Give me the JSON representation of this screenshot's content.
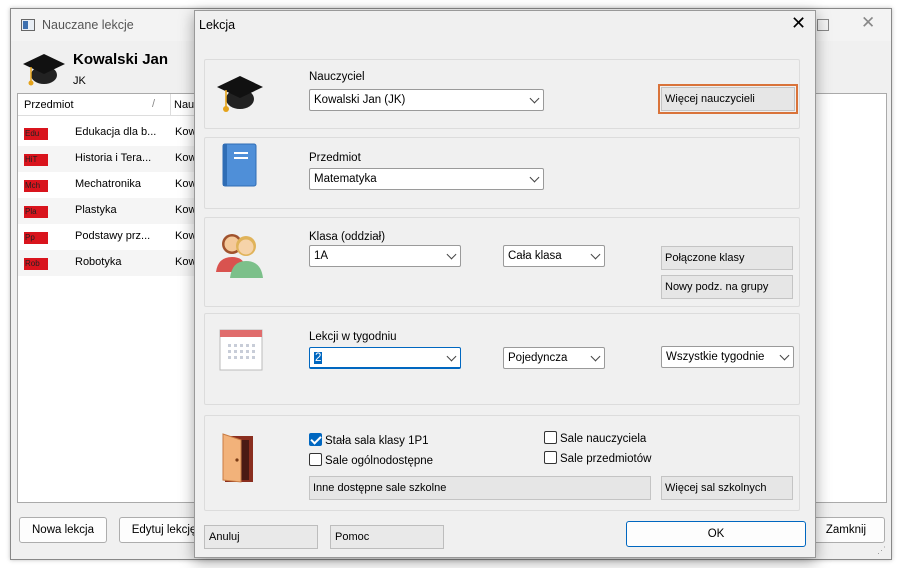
{
  "bg": {
    "title": "Nauczane lekcje",
    "user_name": "Kowalski Jan",
    "user_short": "JK",
    "col_subject": "Przedmiot",
    "col_teacher": "Nauc",
    "rows": [
      {
        "badge": "Edu",
        "name": "Edukacja dla b...",
        "teacher": "Kow"
      },
      {
        "badge": "HiT",
        "name": "Historia i Tera...",
        "teacher": "Kow"
      },
      {
        "badge": "Mch",
        "name": "Mechatronika",
        "teacher": "Kow"
      },
      {
        "badge": "Pla",
        "name": "Plastyka",
        "teacher": "Kow"
      },
      {
        "badge": "Pp",
        "name": "Podstawy prz...",
        "teacher": "Kow"
      },
      {
        "badge": "Rob",
        "name": "Robotyka",
        "teacher": "Kow"
      }
    ],
    "btn_new": "Nowa lekcja",
    "btn_edit": "Edytuj lekcję",
    "btn_close": "Zamknij"
  },
  "dialog": {
    "title": "Lekcja",
    "teacher_label": "Nauczyciel",
    "teacher_value": "Kowalski Jan (JK)",
    "more_teachers": "Więcej nauczycieli",
    "subject_label": "Przedmiot",
    "subject_value": "Matematyka",
    "class_label": "Klasa (oddział)",
    "class_value": "1A",
    "group_value": "Cała klasa",
    "joined_classes": "Połączone klasy",
    "new_split": "Nowy podz. na grupy",
    "lessons_label": "Lekcji w tygodniu",
    "lessons_value": "2",
    "single_value": "Pojedyncza",
    "weeks_value": "Wszystkie tygodnie",
    "room_fixed": "Stała sala klasy 1P1",
    "room_fixed_checked": true,
    "room_public": "Sale ogólnodostępne",
    "room_teacher": "Sale nauczyciela",
    "room_subject": "Sale przedmiotów",
    "other_rooms": "Inne dostępne sale szkolne",
    "more_rooms": "Więcej sal szkolnych",
    "cancel": "Anuluj",
    "help": "Pomoc",
    "ok": "OK"
  },
  "colors": {
    "accent": "#0067c0",
    "highlight_border": "#d9733a",
    "badge_red": "#d9141d"
  }
}
